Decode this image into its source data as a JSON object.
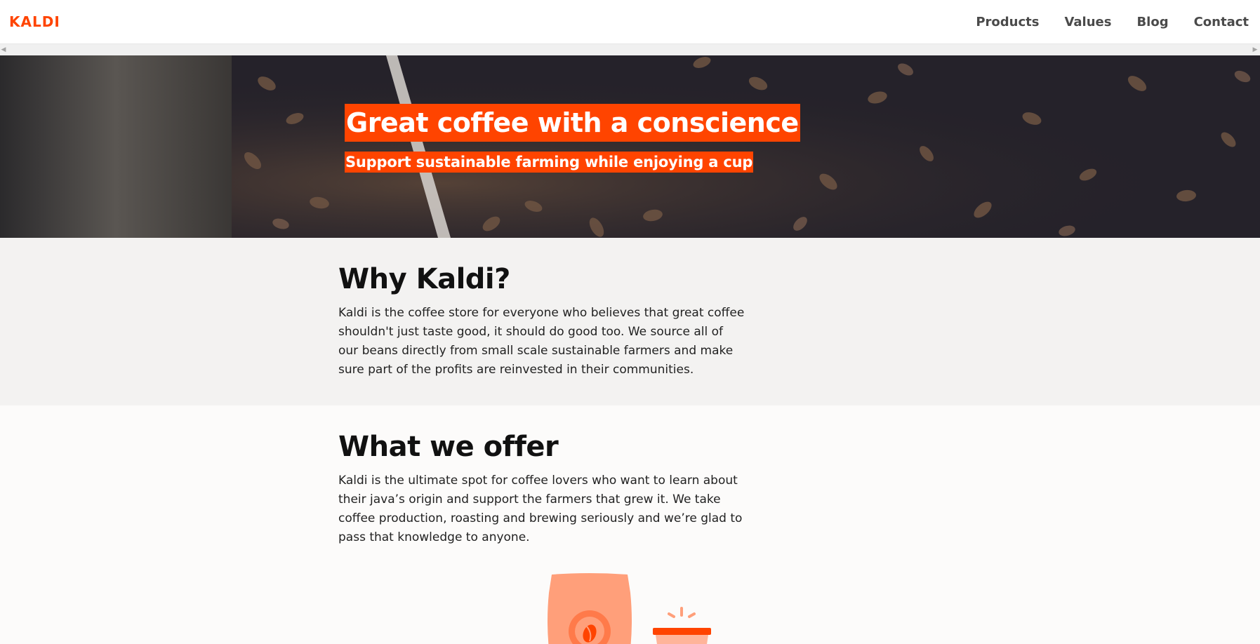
{
  "nav": {
    "logo": "KALDI",
    "links": [
      "Products",
      "Values",
      "Blog",
      "Contact"
    ]
  },
  "hero": {
    "title": "Great coffee with a conscience",
    "subtitle": "Support sustainable farming while enjoying a cup"
  },
  "why": {
    "title": "Why Kaldi?",
    "text": "Kaldi is the coffee store for everyone who believes that great coffee shouldn't just taste good, it should do good too. We source all of our beans directly from small scale sustainable farmers and make sure part of the profits are reinvested in their communities."
  },
  "offer": {
    "title": "What we offer",
    "text": "Kaldi is the ultimate spot for coffee lovers who want to learn about their java’s origin and support the farmers that grew it. We take coffee production, roasting and brewing seriously and we’re glad to pass that knowledge to anyone."
  },
  "colors": {
    "brand": "#ff4400",
    "hero_bg": "#2a2630",
    "why_bg": "#f3f2f1",
    "offer_bg": "#fcfbfa",
    "illustration_light": "#ff9f7a"
  },
  "icons": [
    "chevron-left-icon",
    "chevron-right-icon",
    "coffee-bag-icon",
    "coffee-bean-icon",
    "coffee-cup-icon"
  ]
}
